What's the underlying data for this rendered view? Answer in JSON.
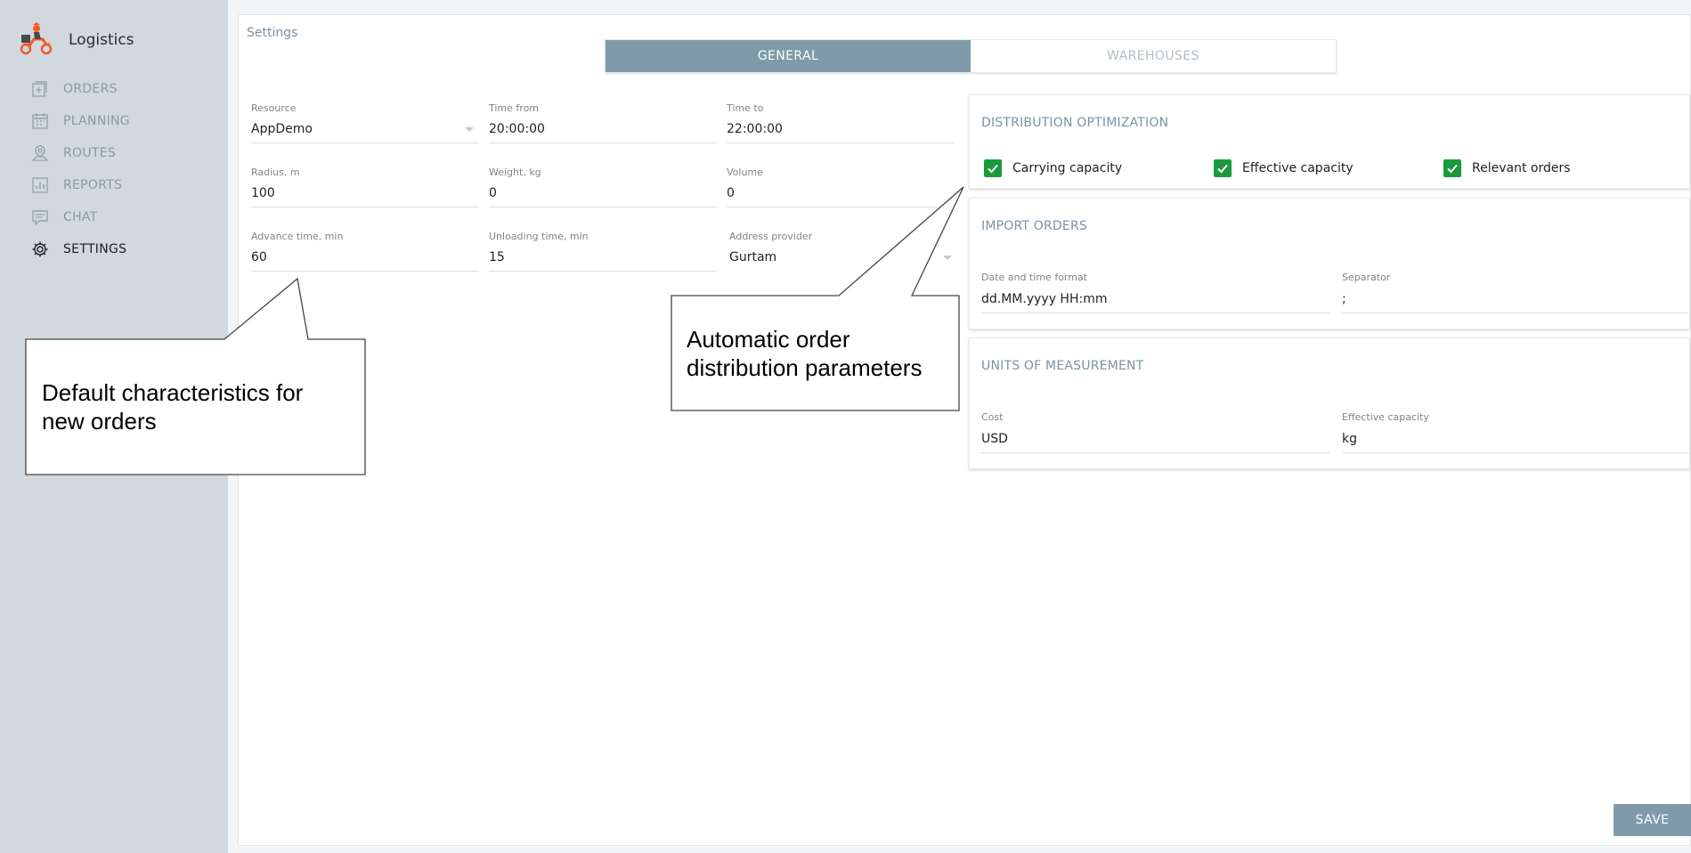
{
  "app": {
    "title": "Logistics"
  },
  "sidebar": {
    "items": [
      {
        "label": "ORDERS",
        "icon": "orders-icon",
        "active": false
      },
      {
        "label": "PLANNING",
        "icon": "calendar-icon",
        "active": false
      },
      {
        "label": "ROUTES",
        "icon": "route-pin-icon",
        "active": false
      },
      {
        "label": "REPORTS",
        "icon": "chart-icon",
        "active": false
      },
      {
        "label": "CHAT",
        "icon": "chat-icon",
        "active": false
      },
      {
        "label": "SETTINGS",
        "icon": "gear-icon",
        "active": true
      }
    ]
  },
  "page": {
    "title": "Settings"
  },
  "tabs": [
    {
      "label": "GENERAL",
      "active": true
    },
    {
      "label": "WAREHOUSES",
      "active": false
    }
  ],
  "general_form": {
    "resource": {
      "label": "Resource",
      "value": "AppDemo"
    },
    "time_from": {
      "label": "Time from",
      "value": "20:00:00"
    },
    "time_to": {
      "label": "Time to",
      "value": "22:00:00"
    },
    "radius": {
      "label": "Radius, m",
      "value": "100"
    },
    "weight": {
      "label": "Weight, kg",
      "value": "0"
    },
    "volume": {
      "label": "Volume",
      "value": "0"
    },
    "advance_time": {
      "label": "Advance time, min",
      "value": "60"
    },
    "unloading_time": {
      "label": "Unloading time, min",
      "value": "15"
    },
    "address_provider": {
      "label": "Address provider",
      "value": "Gurtam"
    }
  },
  "distribution_optimization": {
    "title": "DISTRIBUTION OPTIMIZATION",
    "options": [
      {
        "label": "Carrying capacity",
        "checked": true
      },
      {
        "label": "Effective capacity",
        "checked": true
      },
      {
        "label": "Relevant orders",
        "checked": true
      }
    ]
  },
  "import_orders": {
    "title": "IMPORT ORDERS",
    "date_format": {
      "label": "Date and time format",
      "value": "dd.MM.yyyy HH:mm"
    },
    "separator": {
      "label": "Separator",
      "value": ";"
    }
  },
  "units": {
    "title": "UNITS OF MEASUREMENT",
    "cost": {
      "label": "Cost",
      "value": "USD"
    },
    "effective_capacity": {
      "label": "Effective capacity",
      "value": "kg"
    }
  },
  "actions": {
    "save_label": "SAVE"
  },
  "callouts": {
    "left": "Default characteristics for new orders",
    "right": "Automatic order distribution parameters"
  },
  "colors": {
    "sidebar_bg": "#d1d9df",
    "accent": "#7f9ba9",
    "checkbox": "#1a9a3a",
    "logo_orange": "#f15a24"
  }
}
